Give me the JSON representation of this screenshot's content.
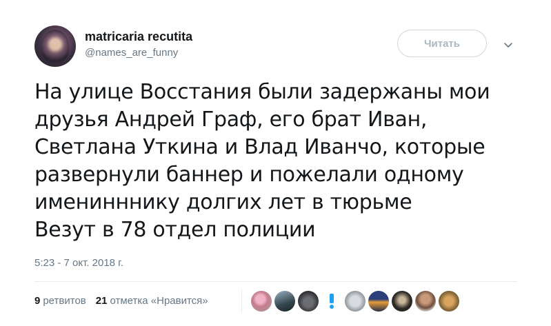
{
  "tweet": {
    "author": {
      "display_name": "matricaria recutita",
      "handle": "@names_are_funny"
    },
    "follow_button_label": "Читать",
    "text": "На улице Восстания были задержаны мои\nдрузья Андрей Граф, его брат Иван,\nСветлана Уткина и Влад Иванчо, которые\nразвернули баннер и пожелали одному\nименинннику долгих лет в тюрьме\nВезут в 78 отдел полиции",
    "timestamp": "5:23 - 7 окт. 2018 г.",
    "stats": {
      "retweets_count": "9",
      "retweets_label": "ретвитов",
      "likes_count": "21",
      "likes_label": "отметка «Нравится»"
    },
    "liker_avatars": [
      "avatar",
      "avatar",
      "avatar",
      "avatar",
      "avatar",
      "avatar",
      "avatar",
      "avatar",
      "avatar"
    ]
  },
  "colors": {
    "text": "#14171a",
    "secondary": "#657786",
    "border": "#e6ecf0",
    "accent": "#1da1f2"
  }
}
